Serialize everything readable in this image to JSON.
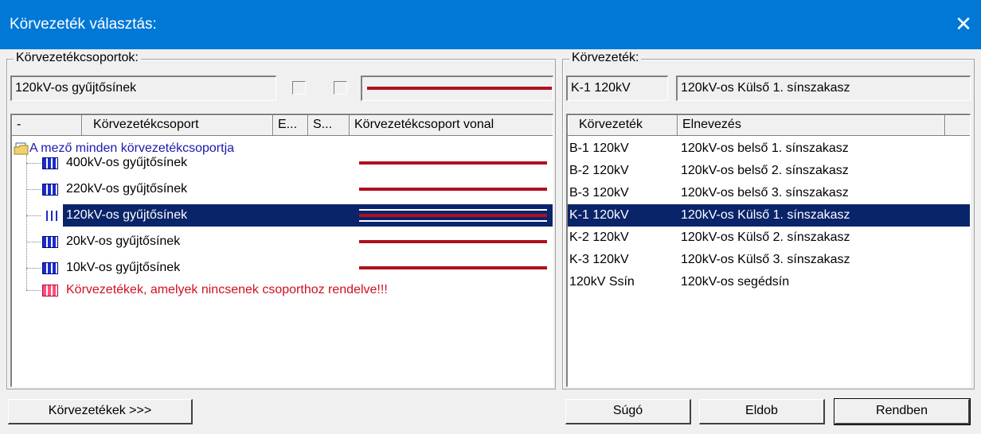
{
  "window": {
    "title": "Körvezeték választás:",
    "close_glyph": "✕"
  },
  "left": {
    "group_title": "Körvezetékcsoportok:",
    "current_group": "120kV-os gyűjtősínek",
    "line_color": "#b01020",
    "columns": [
      "-",
      "Körvezetékcsoport",
      "E...",
      "S...",
      "Körvezetékcsoport vonal"
    ],
    "root": "A mező minden körvezetékcsoportja",
    "items": [
      {
        "label": "400kV-os gyűjtősínek"
      },
      {
        "label": "220kV-os gyűjtősínek"
      },
      {
        "label": "120kV-os gyűjtősínek"
      },
      {
        "label": "20kV-os gyűjtősínek"
      },
      {
        "label": "10kV-os gyűjtősínek"
      }
    ],
    "unassigned": "Körvezetékek, amelyek nincsenek csoporthoz rendelve!!!"
  },
  "right": {
    "group_title": "Körvezeték:",
    "current_code": "K-1 120kV",
    "current_name": "120kV-os Külső 1. sínszakasz",
    "columns": [
      "Körvezeték",
      "Elnevezés"
    ],
    "rows": [
      {
        "code": "B-1 120kV",
        "name": "120kV-os belső 1. sínszakasz"
      },
      {
        "code": "B-2 120kV",
        "name": "120kV-os belső 2. sínszakasz"
      },
      {
        "code": "B-3 120kV",
        "name": "120kV-os belső 3. sínszakasz"
      },
      {
        "code": "K-1 120kV",
        "name": "120kV-os Külső 1. sínszakasz"
      },
      {
        "code": "K-2 120kV",
        "name": "120kV-os Külső 2. sínszakasz"
      },
      {
        "code": "K-3 120kV",
        "name": "120kV-os Külső 3. sínszakasz"
      },
      {
        "code": "120kV Ssín",
        "name": "120kV-os segédsín"
      }
    ]
  },
  "buttons": {
    "lines": "Körvezetékek >>>",
    "help": "Súgó",
    "discard": "Eldob",
    "ok": "Rendben"
  }
}
